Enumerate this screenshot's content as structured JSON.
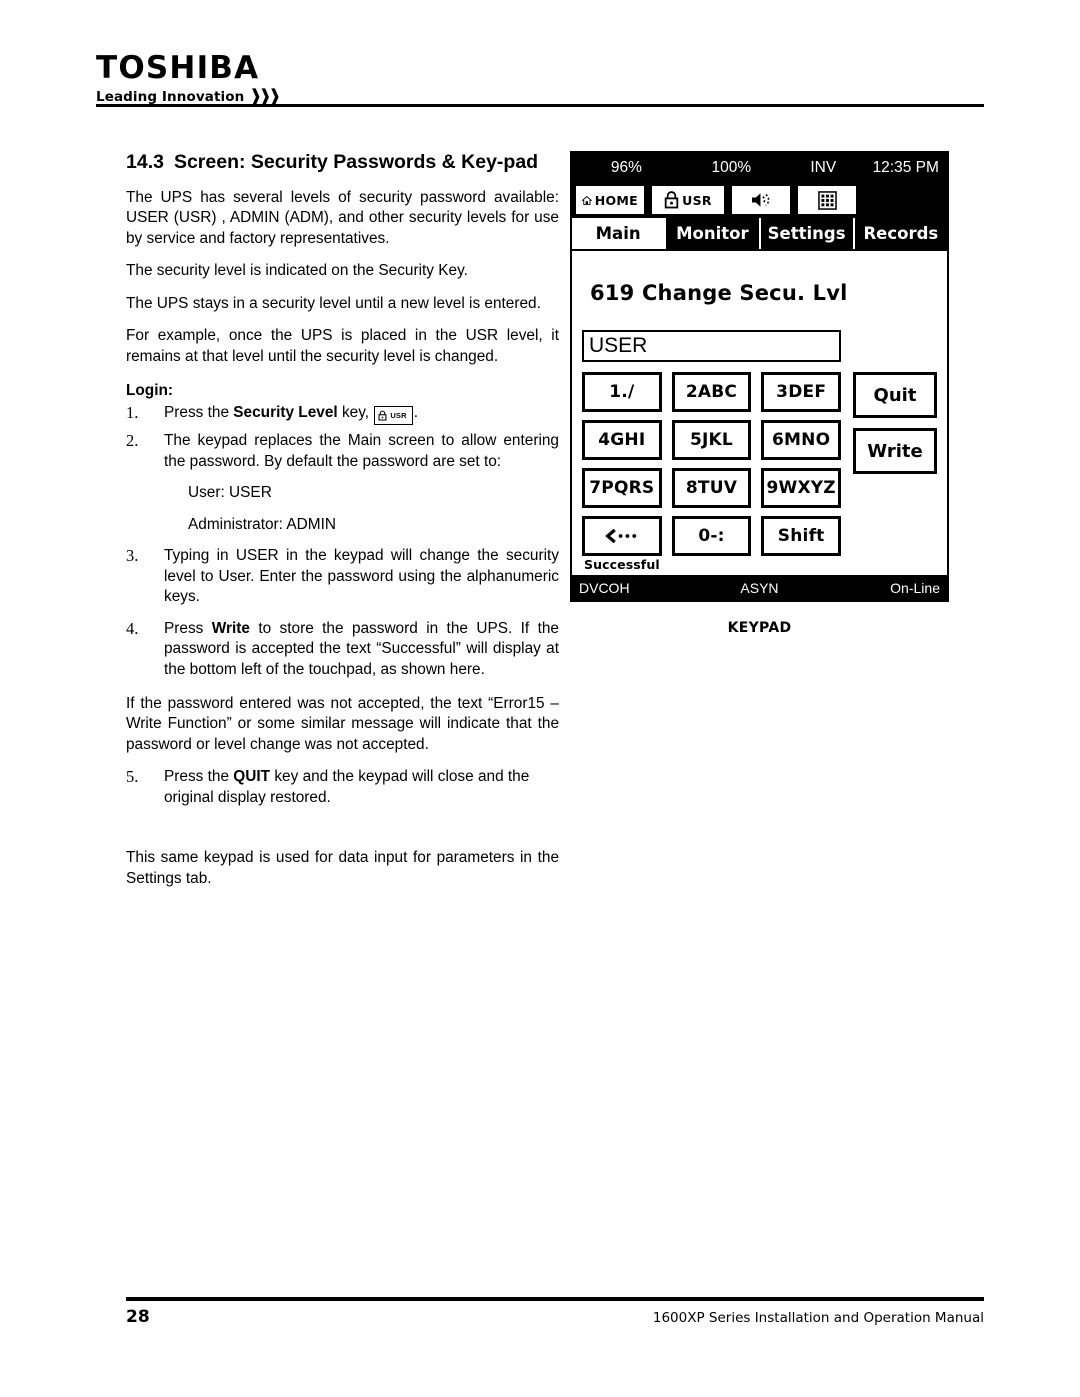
{
  "brand": {
    "name": "TOSHIBA",
    "tagline": "Leading Innovation",
    "chevrons": "»›"
  },
  "section": {
    "number": "14.3",
    "title": "Screen: Security Passwords & Key-pad",
    "paragraphs": [
      "The UPS has several levels of security password available: USER (USR) , ADMIN (ADM), and other security levels for use by service and factory representatives.",
      "The security level is indicated on the Security Key.",
      "The UPS stays in a security level until a new level is entered.",
      "For example, once the UPS is placed in the USR level, it remains at that level until the security level is changed."
    ],
    "login_label": "Login:",
    "steps": [
      {
        "before": "Press the ",
        "bold": "Security Level",
        "after": " key, ",
        "has_key_glyph": true,
        "trailing": "."
      },
      {
        "text": "The keypad replaces the Main screen to allow entering the password. By default  the password are set to:"
      },
      {
        "text": "Typing in USER in the keypad will change the security level to User.  Enter the password using the alphanumeric keys."
      },
      {
        "before": "Press ",
        "bold": "Write",
        "after": " to store the password in the UPS.  If the password is accepted the text “Successful” will display at the bottom left of the touchpad, as shown here."
      },
      {
        "before": "Press the ",
        "bold": "QUIT",
        "after": " key and the keypad will close and the original display restored."
      }
    ],
    "default_credentials": [
      "User: USER",
      "Administrator: ADMIN"
    ],
    "error_paragraph": "If the password entered was not accepted, the text “Error15 – Write Function” or some similar message will indicate that the password or level change was not accepted.",
    "closing_paragraph": "This same keypad is used for data input for parameters in the Settings tab."
  },
  "device": {
    "status": {
      "battery": "96%",
      "load": "100%",
      "mode": "INV",
      "time": "12:35 PM"
    },
    "toolbar": [
      {
        "icon": "home-icon",
        "label": "HOME"
      },
      {
        "icon": "lock-icon",
        "label": "USR"
      },
      {
        "icon": "speaker-mute-icon",
        "label": ""
      },
      {
        "icon": "keypad-grid-icon",
        "label": ""
      }
    ],
    "tabs": [
      {
        "label": "Main",
        "active": true
      },
      {
        "label": "Monitor",
        "active": false
      },
      {
        "label": "Settings",
        "active": false
      },
      {
        "label": "Records",
        "active": false
      }
    ],
    "screen_title": "619 Change Secu. Lvl",
    "entry_value": "USER",
    "keys": [
      "1./",
      "2ABC",
      "3DEF",
      "4GHI",
      "5JKL",
      "6MNO",
      "7PQRS",
      "8TUV",
      "9WXYZ",
      "‹•••",
      "0-:",
      "Shift"
    ],
    "side_keys": [
      "Quit",
      "Write"
    ],
    "message": "Successful",
    "footer": {
      "left": "DVCOH",
      "center": "ASYN",
      "right": "On-Line"
    },
    "caption": "KEYPAD"
  },
  "page_footer": {
    "page_number": "28",
    "manual_title": "1600XP Series Installation and Operation Manual"
  },
  "colors": {
    "ink": "#000000",
    "paper": "#ffffff"
  }
}
